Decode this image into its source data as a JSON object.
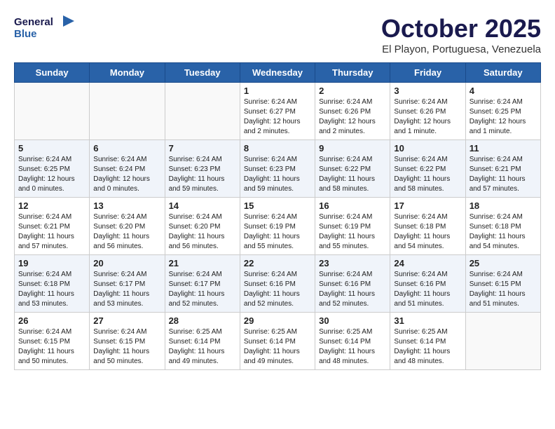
{
  "logo": {
    "line1": "General",
    "line2": "Blue"
  },
  "title": "October 2025",
  "location": "El Playon, Portuguesa, Venezuela",
  "days_header": [
    "Sunday",
    "Monday",
    "Tuesday",
    "Wednesday",
    "Thursday",
    "Friday",
    "Saturday"
  ],
  "weeks": [
    [
      {
        "day": "",
        "info": ""
      },
      {
        "day": "",
        "info": ""
      },
      {
        "day": "",
        "info": ""
      },
      {
        "day": "1",
        "info": "Sunrise: 6:24 AM\nSunset: 6:27 PM\nDaylight: 12 hours and 2 minutes."
      },
      {
        "day": "2",
        "info": "Sunrise: 6:24 AM\nSunset: 6:26 PM\nDaylight: 12 hours and 2 minutes."
      },
      {
        "day": "3",
        "info": "Sunrise: 6:24 AM\nSunset: 6:26 PM\nDaylight: 12 hours and 1 minute."
      },
      {
        "day": "4",
        "info": "Sunrise: 6:24 AM\nSunset: 6:25 PM\nDaylight: 12 hours and 1 minute."
      }
    ],
    [
      {
        "day": "5",
        "info": "Sunrise: 6:24 AM\nSunset: 6:25 PM\nDaylight: 12 hours and 0 minutes."
      },
      {
        "day": "6",
        "info": "Sunrise: 6:24 AM\nSunset: 6:24 PM\nDaylight: 12 hours and 0 minutes."
      },
      {
        "day": "7",
        "info": "Sunrise: 6:24 AM\nSunset: 6:23 PM\nDaylight: 11 hours and 59 minutes."
      },
      {
        "day": "8",
        "info": "Sunrise: 6:24 AM\nSunset: 6:23 PM\nDaylight: 11 hours and 59 minutes."
      },
      {
        "day": "9",
        "info": "Sunrise: 6:24 AM\nSunset: 6:22 PM\nDaylight: 11 hours and 58 minutes."
      },
      {
        "day": "10",
        "info": "Sunrise: 6:24 AM\nSunset: 6:22 PM\nDaylight: 11 hours and 58 minutes."
      },
      {
        "day": "11",
        "info": "Sunrise: 6:24 AM\nSunset: 6:21 PM\nDaylight: 11 hours and 57 minutes."
      }
    ],
    [
      {
        "day": "12",
        "info": "Sunrise: 6:24 AM\nSunset: 6:21 PM\nDaylight: 11 hours and 57 minutes."
      },
      {
        "day": "13",
        "info": "Sunrise: 6:24 AM\nSunset: 6:20 PM\nDaylight: 11 hours and 56 minutes."
      },
      {
        "day": "14",
        "info": "Sunrise: 6:24 AM\nSunset: 6:20 PM\nDaylight: 11 hours and 56 minutes."
      },
      {
        "day": "15",
        "info": "Sunrise: 6:24 AM\nSunset: 6:19 PM\nDaylight: 11 hours and 55 minutes."
      },
      {
        "day": "16",
        "info": "Sunrise: 6:24 AM\nSunset: 6:19 PM\nDaylight: 11 hours and 55 minutes."
      },
      {
        "day": "17",
        "info": "Sunrise: 6:24 AM\nSunset: 6:18 PM\nDaylight: 11 hours and 54 minutes."
      },
      {
        "day": "18",
        "info": "Sunrise: 6:24 AM\nSunset: 6:18 PM\nDaylight: 11 hours and 54 minutes."
      }
    ],
    [
      {
        "day": "19",
        "info": "Sunrise: 6:24 AM\nSunset: 6:18 PM\nDaylight: 11 hours and 53 minutes."
      },
      {
        "day": "20",
        "info": "Sunrise: 6:24 AM\nSunset: 6:17 PM\nDaylight: 11 hours and 53 minutes."
      },
      {
        "day": "21",
        "info": "Sunrise: 6:24 AM\nSunset: 6:17 PM\nDaylight: 11 hours and 52 minutes."
      },
      {
        "day": "22",
        "info": "Sunrise: 6:24 AM\nSunset: 6:16 PM\nDaylight: 11 hours and 52 minutes."
      },
      {
        "day": "23",
        "info": "Sunrise: 6:24 AM\nSunset: 6:16 PM\nDaylight: 11 hours and 52 minutes."
      },
      {
        "day": "24",
        "info": "Sunrise: 6:24 AM\nSunset: 6:16 PM\nDaylight: 11 hours and 51 minutes."
      },
      {
        "day": "25",
        "info": "Sunrise: 6:24 AM\nSunset: 6:15 PM\nDaylight: 11 hours and 51 minutes."
      }
    ],
    [
      {
        "day": "26",
        "info": "Sunrise: 6:24 AM\nSunset: 6:15 PM\nDaylight: 11 hours and 50 minutes."
      },
      {
        "day": "27",
        "info": "Sunrise: 6:24 AM\nSunset: 6:15 PM\nDaylight: 11 hours and 50 minutes."
      },
      {
        "day": "28",
        "info": "Sunrise: 6:25 AM\nSunset: 6:14 PM\nDaylight: 11 hours and 49 minutes."
      },
      {
        "day": "29",
        "info": "Sunrise: 6:25 AM\nSunset: 6:14 PM\nDaylight: 11 hours and 49 minutes."
      },
      {
        "day": "30",
        "info": "Sunrise: 6:25 AM\nSunset: 6:14 PM\nDaylight: 11 hours and 48 minutes."
      },
      {
        "day": "31",
        "info": "Sunrise: 6:25 AM\nSunset: 6:14 PM\nDaylight: 11 hours and 48 minutes."
      },
      {
        "day": "",
        "info": ""
      }
    ]
  ]
}
